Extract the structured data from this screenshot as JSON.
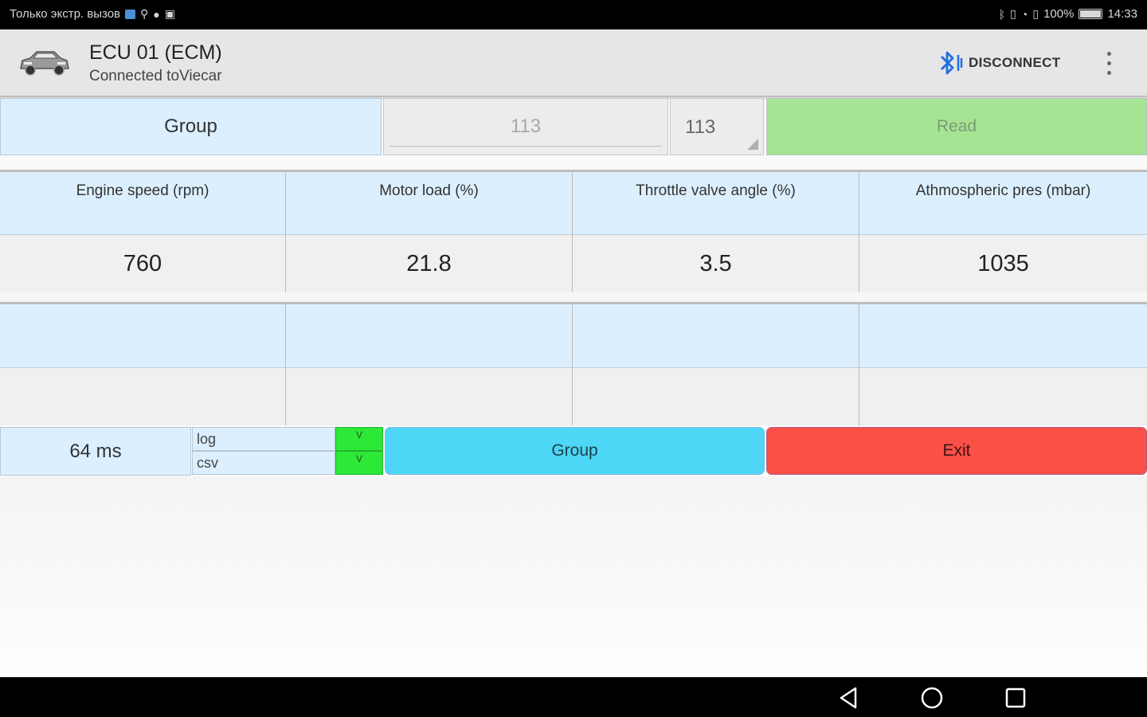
{
  "status_bar": {
    "left_text": "Только экстр. вызов",
    "battery": "100%",
    "time": "14:33"
  },
  "app_bar": {
    "title": "ECU 01 (ECM)",
    "subtitle": "Connected toViecar",
    "disconnect_label": "DISCONNECT"
  },
  "group_row": {
    "group_label": "Group",
    "group_input_value": "113",
    "group_spinner_value": "113",
    "read_label": "Read"
  },
  "measurements": {
    "headers": [
      "Engine speed (rpm)",
      "Motor load (%)",
      "Throttle valve angle (%)",
      "Athmospheric pres (mbar)"
    ],
    "values": [
      "760",
      "21.8",
      "3.5",
      "1035"
    ]
  },
  "measurements2": {
    "headers": [
      "",
      "",
      "",
      ""
    ],
    "values": [
      "",
      "",
      "",
      ""
    ]
  },
  "bottom": {
    "interval": "64 ms",
    "log_label": "log",
    "log_checked": "v",
    "csv_label": "csv",
    "csv_checked": "v",
    "group_button": "Group",
    "exit_button": "Exit"
  },
  "colors": {
    "header_bg": "#dcefff",
    "read_bg": "#a6e494",
    "group_btn_bg": "#4dd6f5",
    "exit_btn_bg": "#fa5046",
    "check_bg": "#2ee838"
  }
}
